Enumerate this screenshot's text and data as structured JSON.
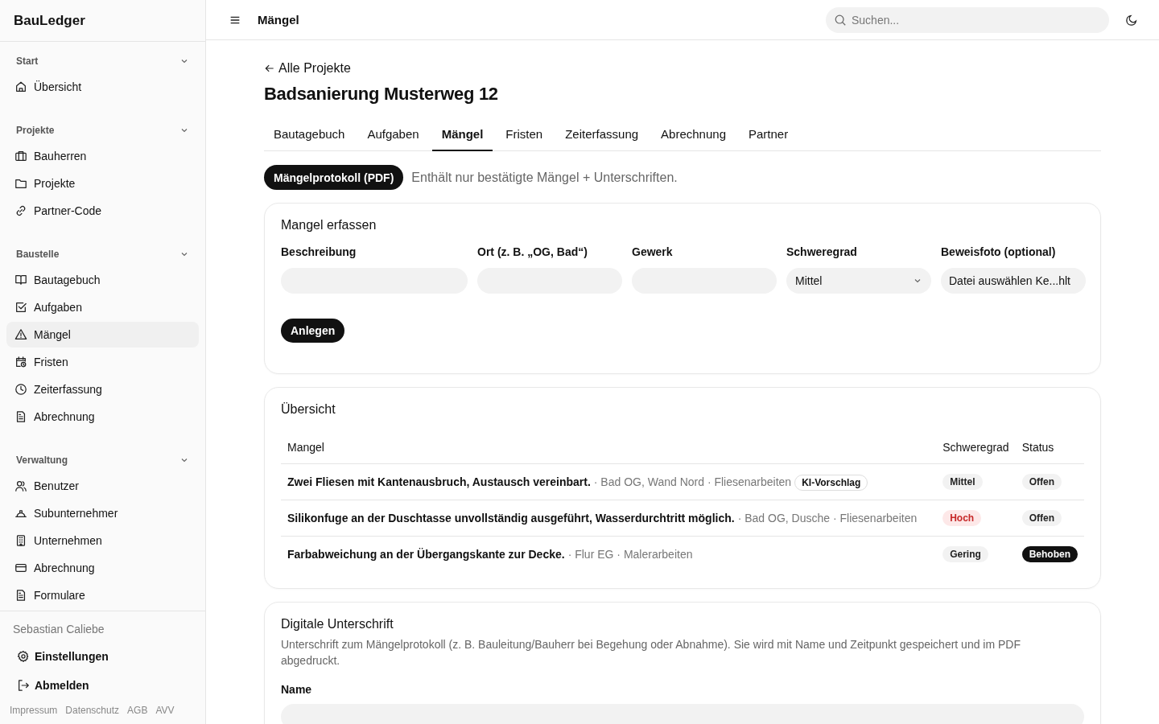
{
  "sidebar": {
    "logo": "BauLedger",
    "sections": [
      {
        "title": "Start",
        "expanded": true,
        "items": [
          {
            "label": "Übersicht",
            "kind": "home",
            "selected": false
          }
        ]
      },
      {
        "title": "Projekte",
        "expanded": true,
        "items": [
          {
            "label": "Bauherren",
            "kind": "briefcase",
            "selected": false
          },
          {
            "label": "Projekte",
            "kind": "folder",
            "selected": false
          },
          {
            "label": "Partner-Code",
            "kind": "link",
            "selected": false
          }
        ]
      },
      {
        "title": "Baustelle",
        "expanded": true,
        "items": [
          {
            "label": "Bautagebuch",
            "kind": "book",
            "selected": false
          },
          {
            "label": "Aufgaben",
            "kind": "checkbox",
            "selected": false
          },
          {
            "label": "Mängel",
            "kind": "warning",
            "selected": true
          },
          {
            "label": "Fristen",
            "kind": "calendar",
            "selected": false
          },
          {
            "label": "Zeiterfassung",
            "kind": "clock",
            "selected": false
          },
          {
            "label": "Abrechnung",
            "kind": "file",
            "selected": false
          }
        ]
      },
      {
        "title": "Verwaltung",
        "expanded": true,
        "items": [
          {
            "label": "Benutzer",
            "kind": "users",
            "selected": false
          },
          {
            "label": "Subunternehmer",
            "kind": "hardhat",
            "selected": false
          },
          {
            "label": "Unternehmen",
            "kind": "office",
            "selected": false
          },
          {
            "label": "Abrechnung",
            "kind": "card",
            "selected": false
          },
          {
            "label": "Formulare",
            "kind": "file",
            "selected": false
          }
        ]
      }
    ],
    "user": "Sebastian Caliebe",
    "actions": [
      {
        "label": "Einstellungen",
        "kind": "gear"
      },
      {
        "label": "Abmelden",
        "kind": "logout"
      }
    ],
    "footer_links": [
      "Impressum",
      "Datenschutz",
      "AGB",
      "AVV"
    ]
  },
  "header": {
    "title": "Mängel",
    "search": {
      "placeholder": "Suchen..."
    }
  },
  "back_link": "Alle Projekte",
  "project_title": "Badsanierung Musterweg 12",
  "tabs": [
    {
      "label": "Bautagebuch",
      "selected": false
    },
    {
      "label": "Aufgaben",
      "selected": false
    },
    {
      "label": "Mängel",
      "selected": true
    },
    {
      "label": "Fristen",
      "selected": false
    },
    {
      "label": "Zeiterfassung",
      "selected": false
    },
    {
      "label": "Abrechnung",
      "selected": false
    },
    {
      "label": "Partner",
      "selected": false
    }
  ],
  "pdf_button": "Mängelprotokoll (PDF)",
  "pdf_note": "Enthält nur bestätigte Mängel + Unterschriften.",
  "form": {
    "title": "Mangel erfassen",
    "fields": [
      {
        "label": "Beschreibung",
        "kind": "text"
      },
      {
        "label": "Ort (z. B. „OG, Bad“)",
        "kind": "text"
      },
      {
        "label": "Gewerk",
        "kind": "text"
      },
      {
        "label": "Schweregrad",
        "kind": "select",
        "value": "Mittel"
      },
      {
        "label": "Beweisfoto (optional)",
        "kind": "file",
        "value": "Datei auswählen Ke...hlt"
      }
    ],
    "submit": "Anlegen"
  },
  "overview": {
    "title": "Übersicht",
    "columns": [
      "Mangel",
      "Schweregrad",
      "Status"
    ],
    "rows": [
      {
        "title": "Zwei Fliesen mit Kantenausbruch, Austausch vereinbart.",
        "meta": "· Bad OG, Wand Nord · Fliesenarbeiten",
        "tag": "KI-Vorschlag",
        "severity": {
          "label": "Mittel",
          "kind": "neutral"
        },
        "status": {
          "label": "Offen",
          "kind": "neutral"
        }
      },
      {
        "title": "Silikonfuge an der Duschtasse unvollständig ausgeführt, Wasserdurchtritt möglich.",
        "meta": "· Bad OG, Dusche · Fliesenarbeiten",
        "severity": {
          "label": "Hoch",
          "kind": "danger"
        },
        "status": {
          "label": "Offen",
          "kind": "neutral"
        }
      },
      {
        "title": "Farbabweichung an der Übergangskante zur Decke.",
        "meta": "· Flur EG · Malerarbeiten",
        "severity": {
          "label": "Gering",
          "kind": "neutral"
        },
        "status": {
          "label": "Behoben",
          "kind": "dark"
        }
      }
    ]
  },
  "signature": {
    "title": "Digitale Unterschrift",
    "description": "Unterschrift zum Mängelprotokoll (z. B. Bauleitung/Bauherr bei Begehung oder Abnahme). Sie wird mit Name und Zeitpunkt gespeichert und im PDF abgedruckt.",
    "name_label": "Name"
  }
}
